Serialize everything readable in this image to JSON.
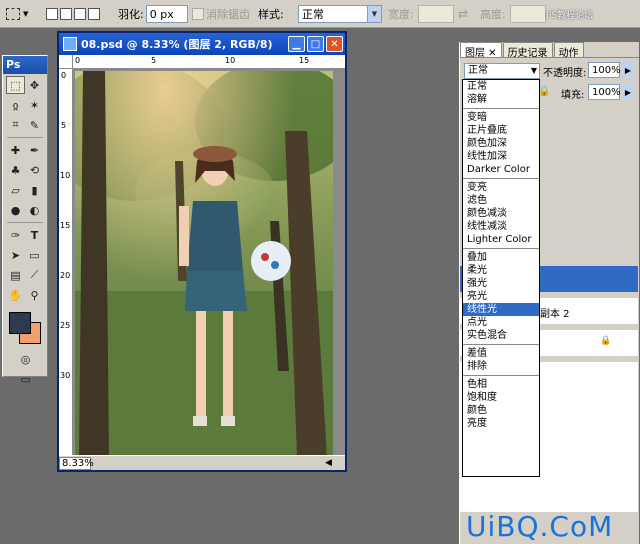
{
  "options_bar": {
    "feather_label": "羽化:",
    "feather_value": "0 px",
    "antialias_label": "消除锯齿",
    "style_label": "样式:",
    "style_value": "正常",
    "width_label": "宽度:",
    "height_label": "高度:"
  },
  "toolbox": {
    "title": "Ps"
  },
  "document": {
    "title": "08.psd @ 8.33% (图层 2, RGB/8)",
    "zoom": "8.33%",
    "ruler_top_ticks": [
      "0",
      "5",
      "10",
      "15"
    ],
    "ruler_left_ticks": [
      "0",
      "5",
      "10",
      "15",
      "20",
      "25",
      "30"
    ]
  },
  "panel": {
    "tabs": [
      "图层",
      "历史记录",
      "动作"
    ],
    "blend_mode": "正常",
    "opacity_label": "不透明度:",
    "opacity_value": "100%",
    "fill_label": "填充:",
    "fill_value": "100%",
    "layer_name": "副本 2"
  },
  "blend_menu": {
    "groups": [
      [
        "正常",
        "溶解"
      ],
      [
        "变暗",
        "正片叠底",
        "颜色加深",
        "线性加深",
        "Darker Color"
      ],
      [
        "变亮",
        "滤色",
        "颜色减淡",
        "线性减淡",
        "Lighter Color"
      ],
      [
        "叠加",
        "柔光",
        "强光",
        "亮光",
        "线性光",
        "点光",
        "实色混合"
      ],
      [
        "差值",
        "排除"
      ],
      [
        "色相",
        "饱和度",
        "颜色",
        "亮度"
      ]
    ],
    "selected": "线性光"
  },
  "watermark": {
    "brand": "UiBQ.CoM",
    "top_text": "PS教程论坛"
  },
  "colors": {
    "foreground": "#2e3a52",
    "background": "#f0a06c",
    "selection": "#316ac5"
  }
}
